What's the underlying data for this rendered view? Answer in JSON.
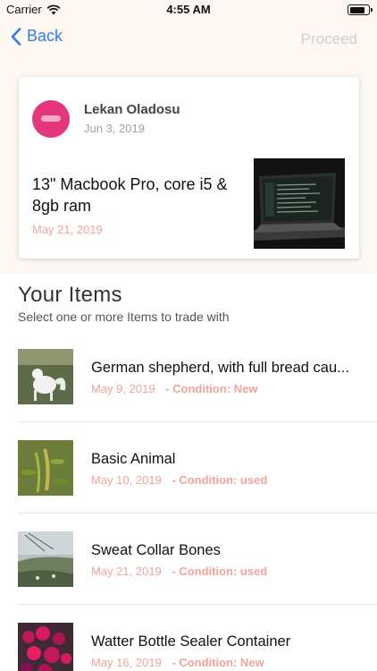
{
  "status_bar": {
    "carrier": "Carrier",
    "time": "4:55 AM"
  },
  "nav": {
    "back_label": "Back",
    "proceed_label": "Proceed"
  },
  "offer_card": {
    "owner_name": "Lekan Oladosu",
    "owner_date": "Jun 3, 2019",
    "item_title": "13\" Macbook Pro, core i5 & 8gb ram",
    "item_date": "May 21, 2019"
  },
  "your_items": {
    "heading": "Your Items",
    "subheading": "Select one or more Items to trade with",
    "items": [
      {
        "name": "German shepherd, with full bread cau...",
        "date": "May 9, 2019",
        "condition": "- Condition: New"
      },
      {
        "name": "Basic Animal",
        "date": "May 10, 2019",
        "condition": "- Condition: used"
      },
      {
        "name": "Sweat Collar Bones",
        "date": "May 21, 2019",
        "condition": "- Condition: used"
      },
      {
        "name": "Watter Bottle Sealer Container",
        "date": "May 16, 2019",
        "condition": "- Condition: New"
      }
    ]
  },
  "colors": {
    "accent": "#2f7fe0",
    "date_pink": "#f0a49a",
    "avatar": "#e4367c",
    "proceed_disabled": "#cfcfcf"
  },
  "icons": [
    "wifi-icon",
    "battery-icon",
    "back-chevron-icon"
  ]
}
